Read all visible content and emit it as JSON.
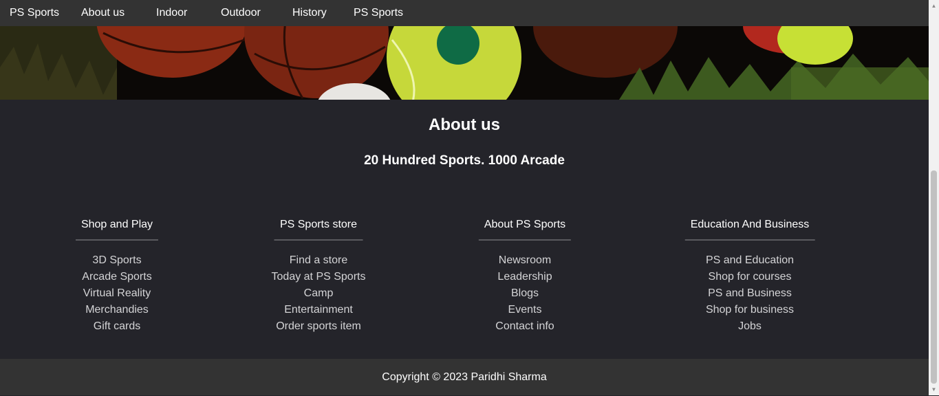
{
  "nav": {
    "items": [
      {
        "label": "PS Sports"
      },
      {
        "label": "About us"
      },
      {
        "label": "Indoor"
      },
      {
        "label": "Outdoor"
      },
      {
        "label": "History"
      },
      {
        "label": "PS Sports"
      }
    ]
  },
  "about": {
    "title": "About us",
    "subtitle": "20 Hundred Sports. 1000 Arcade"
  },
  "footer": {
    "columns": [
      {
        "heading": "Shop and Play",
        "links": [
          "3D Sports",
          "Arcade Sports",
          "Virtual Reality",
          "Merchandies",
          "Gift cards"
        ]
      },
      {
        "heading": "PS Sports store",
        "links": [
          "Find a store",
          "Today at PS Sports",
          "Camp",
          "Entertainment",
          "Order sports item"
        ]
      },
      {
        "heading": "About PS Sports",
        "links": [
          "Newsroom",
          "Leadership",
          "Blogs",
          "Events",
          "Contact info"
        ]
      },
      {
        "heading": "Education And Business",
        "links": [
          "PS and Education",
          "Shop for courses",
          "PS and Business",
          "Shop for business",
          "Jobs"
        ]
      }
    ],
    "copyright": "Copyright © 2023 Paridhi Sharma"
  },
  "colors": {
    "nav_bg": "#333333",
    "page_bg": "#24242a",
    "text": "#ffffff",
    "link_text": "#d4d4d6"
  }
}
